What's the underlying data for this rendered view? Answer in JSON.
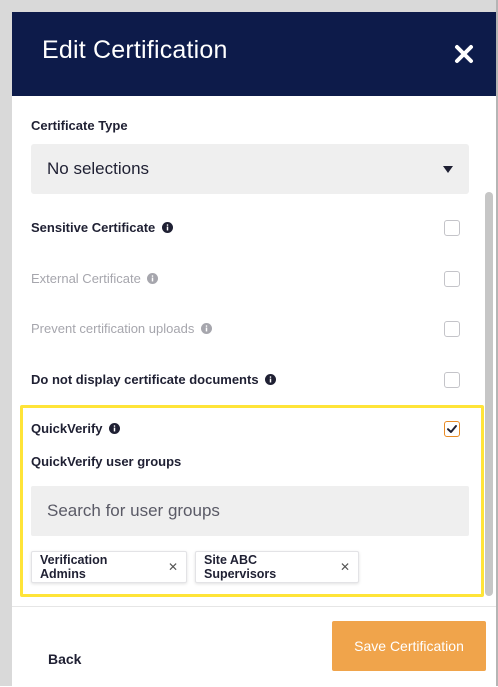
{
  "header": {
    "title": "Edit Certification"
  },
  "certificate_type": {
    "label": "Certificate Type",
    "selected": "No selections"
  },
  "options": [
    {
      "label": "Sensitive Certificate",
      "checked": false,
      "disabled": false
    },
    {
      "label": "External Certificate",
      "checked": false,
      "disabled": true
    },
    {
      "label": "Prevent certification uploads",
      "checked": false,
      "disabled": true
    },
    {
      "label": "Do not display certificate documents",
      "checked": false,
      "disabled": false
    },
    {
      "label": "QuickVerify",
      "checked": true,
      "disabled": false
    }
  ],
  "quickverify": {
    "groups_label": "QuickVerify user groups",
    "search_placeholder": "Search for user groups",
    "chips": [
      "Verification Admins",
      "Site ABC Supervisors"
    ]
  },
  "footer": {
    "back_label": "Back",
    "save_label": "Save Certification"
  },
  "colors": {
    "header": "#0d1b4a",
    "accent": "#f0a44b",
    "checkbox_checked": "#e88a24",
    "highlight": "#ffe438"
  }
}
